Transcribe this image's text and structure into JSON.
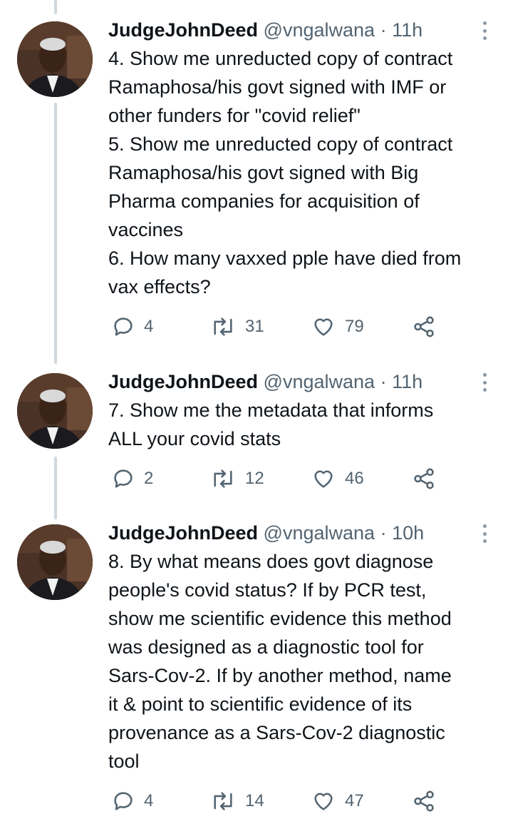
{
  "tweets": [
    {
      "author_name": "JudgeJohnDeed",
      "handle": "@vngalwana",
      "separator": "·",
      "time": "11h",
      "lines": [
        "4. Show me unreducted copy of contract",
        "Ramaphosa/his govt signed with IMF or",
        "other funders for \"covid relief\"",
        "5. Show me unreducted copy of contract",
        "Ramaphosa/his govt signed with Big",
        "Pharma companies for acquisition of",
        "vaccines",
        "6. How many vaxxed pple have died from",
        "vax effects?"
      ],
      "replies": "4",
      "retweets": "31",
      "likes": "79"
    },
    {
      "author_name": "JudgeJohnDeed",
      "handle": "@vngalwana",
      "separator": "·",
      "time": "11h",
      "lines": [
        "7. Show me the metadata that informs",
        "ALL your covid stats"
      ],
      "replies": "2",
      "retweets": "12",
      "likes": "46"
    },
    {
      "author_name": "JudgeJohnDeed",
      "handle": "@vngalwana",
      "separator": "·",
      "time": "10h",
      "lines": [
        "8. By what means does govt diagnose",
        "people's covid status? If by PCR test,",
        "show me scientific evidence this method",
        "was designed as a diagnostic tool for",
        "Sars-Cov-2. If by another method, name",
        "it & point to scientific evidence of its",
        "provenance as a Sars-Cov-2 diagnostic",
        "tool"
      ],
      "replies": "4",
      "retweets": "14",
      "likes": "47"
    }
  ],
  "icons": {
    "reply": "reply-icon",
    "retweet": "retweet-icon",
    "like": "heart-icon",
    "share": "share-icon",
    "more": "more-options-icon"
  },
  "colors": {
    "text_primary": "#0f1419",
    "text_secondary": "#536471",
    "thread_line": "#cfd9de"
  }
}
